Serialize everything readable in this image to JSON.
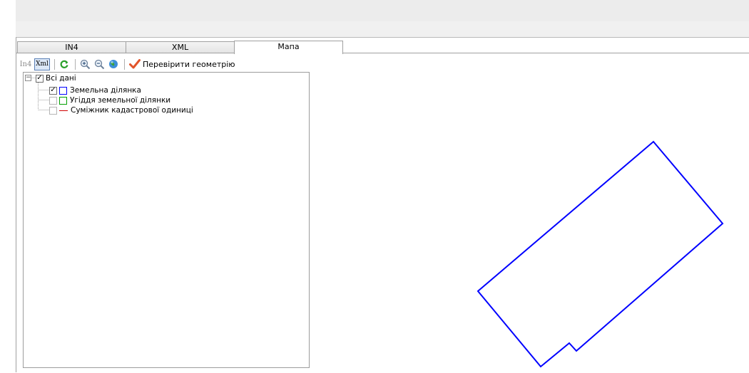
{
  "tabs": [
    {
      "label": "IN4",
      "active": false
    },
    {
      "label": "XML",
      "active": false
    },
    {
      "label": "Мапа",
      "active": true
    }
  ],
  "toolbar": {
    "in4_label": "In4",
    "xml_label": "Xml",
    "refresh_icon": "refresh-icon",
    "zoom_in_icon": "zoom-in-icon",
    "zoom_out_icon": "zoom-out-icon",
    "globe_icon": "globe-icon",
    "check_geometry_label": "Перевірити геометрію"
  },
  "tree": {
    "root": {
      "label": "Всі дані",
      "checked": true,
      "expanded": true
    },
    "items": [
      {
        "label": "Земельна ділянка",
        "checked": true,
        "swatch": "square",
        "color": "#0000ff"
      },
      {
        "label": "Угіддя земельної ділянки",
        "checked": false,
        "swatch": "square",
        "color": "#00a000"
      },
      {
        "label": "Суміжник кадастрової одиниці",
        "checked": false,
        "swatch": "line",
        "color": "#d00000"
      }
    ]
  },
  "map": {
    "parcel_outline_color": "#0000ff"
  }
}
